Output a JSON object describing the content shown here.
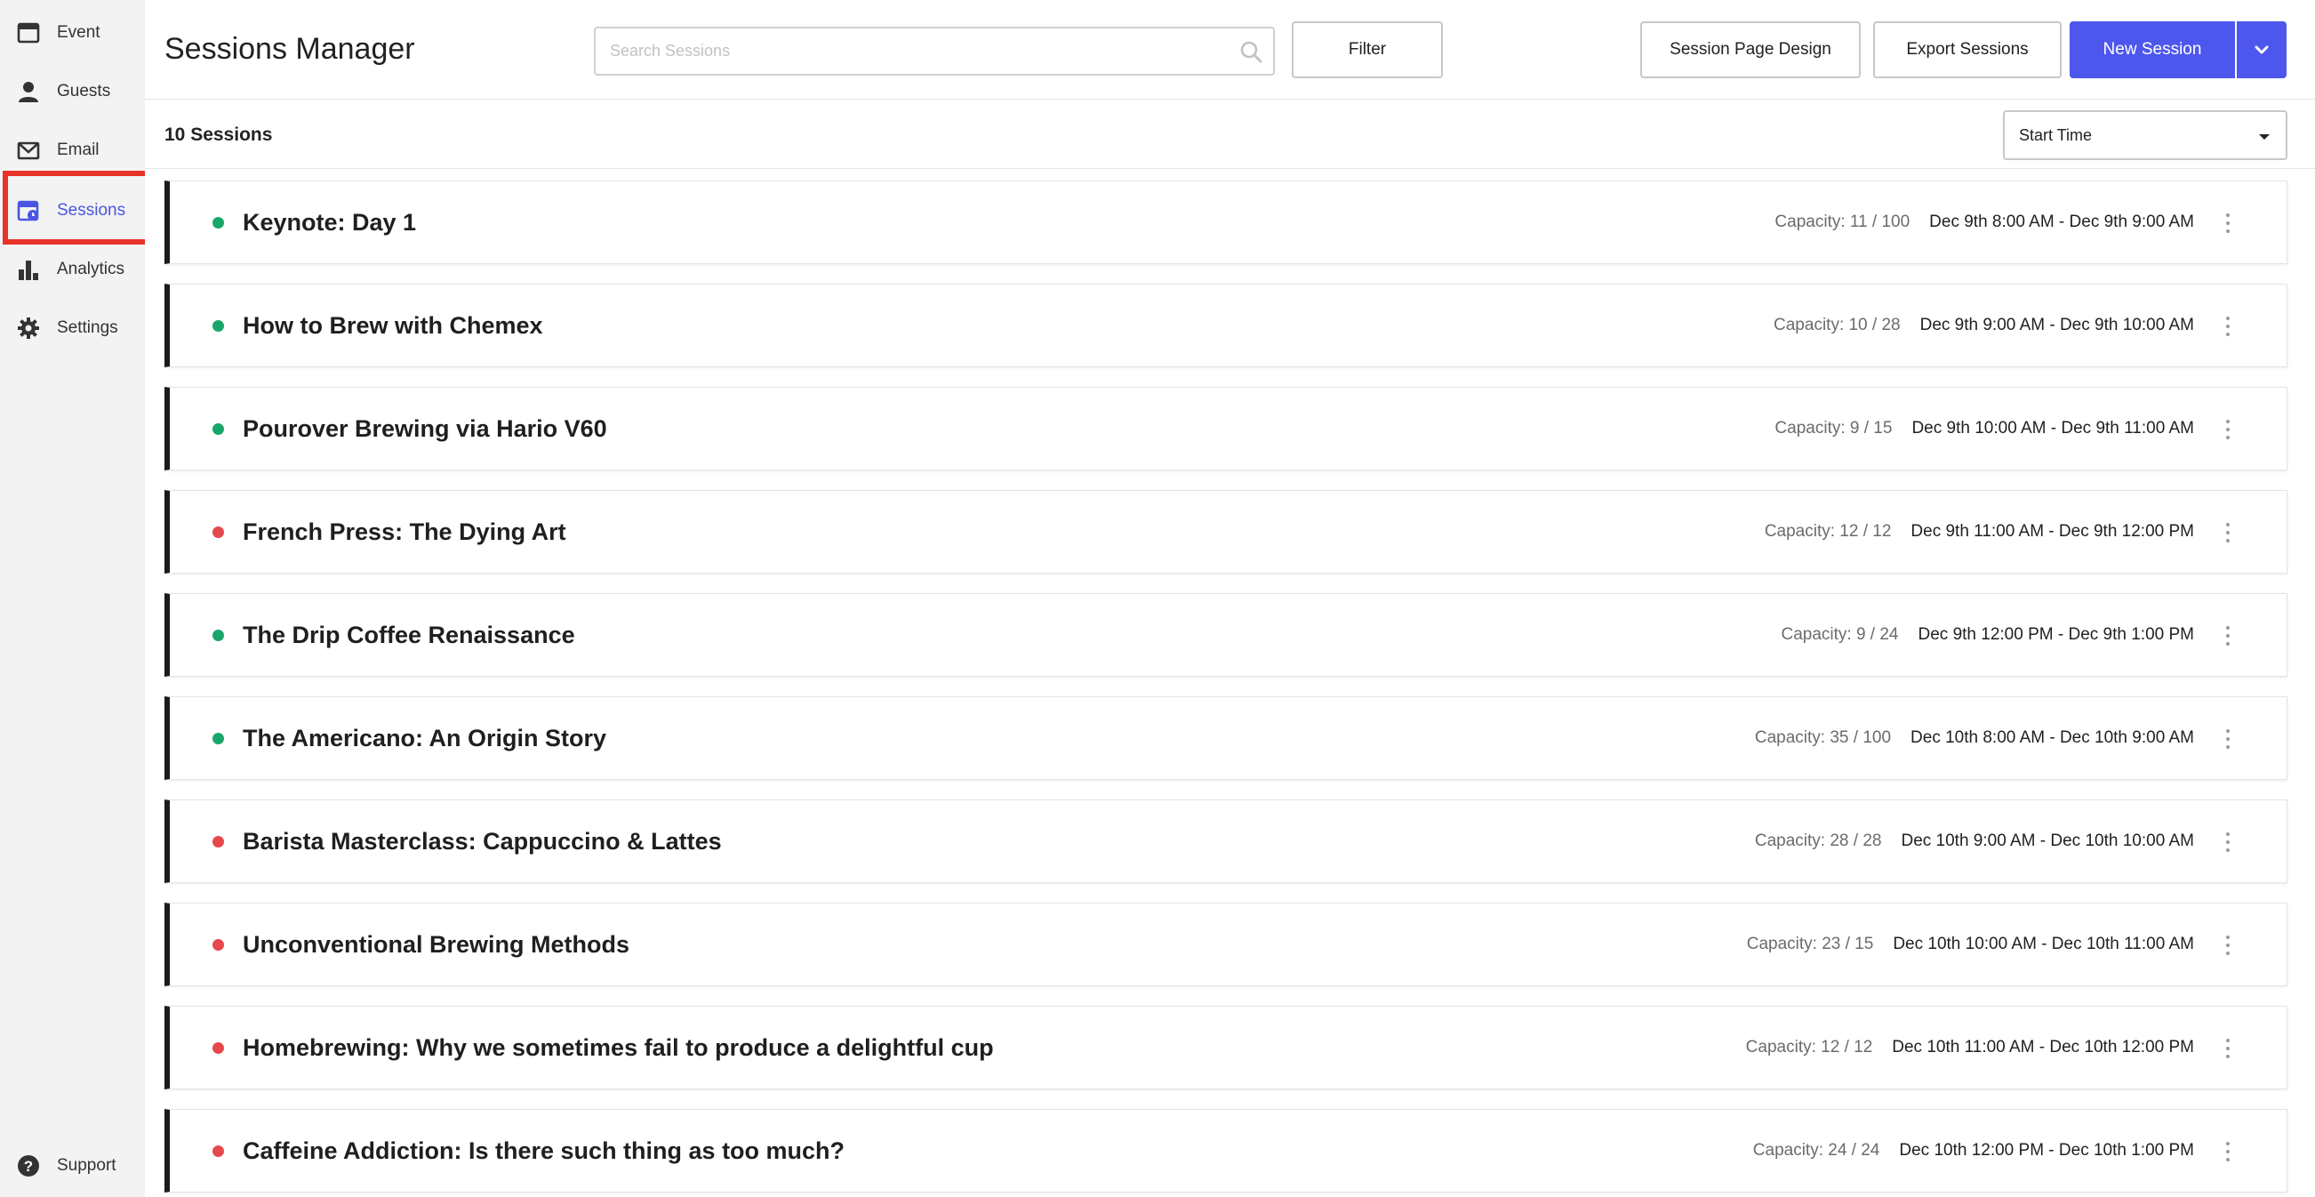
{
  "sidebar": {
    "items": [
      {
        "label": "Event",
        "icon": "calendar-icon"
      },
      {
        "label": "Guests",
        "icon": "person-icon"
      },
      {
        "label": "Email",
        "icon": "envelope-icon"
      },
      {
        "label": "Sessions",
        "icon": "sessions-icon",
        "active": true
      },
      {
        "label": "Analytics",
        "icon": "bar-chart-icon"
      },
      {
        "label": "Settings",
        "icon": "gear-icon"
      }
    ],
    "support_label": "Support"
  },
  "header": {
    "title": "Sessions Manager",
    "search_placeholder": "Search Sessions",
    "filter_label": "Filter",
    "design_label": "Session Page Design",
    "export_label": "Export Sessions",
    "new_label": "New Session"
  },
  "list": {
    "count_label": "10 Sessions",
    "sort_value": "Start Time",
    "sessions": [
      {
        "title": "Keynote: Day 1",
        "capacity": "Capacity: 11 / 100",
        "time": "Dec 9th 8:00 AM - Dec 9th 9:00 AM",
        "status": "available"
      },
      {
        "title": "How to Brew with Chemex",
        "capacity": "Capacity: 10 / 28",
        "time": "Dec 9th 9:00 AM - Dec 9th 10:00 AM",
        "status": "available"
      },
      {
        "title": "Pourover Brewing via Hario V60",
        "capacity": "Capacity: 9 / 15",
        "time": "Dec 9th 10:00 AM - Dec 9th 11:00 AM",
        "status": "available"
      },
      {
        "title": "French Press: The Dying Art",
        "capacity": "Capacity: 12 / 12",
        "time": "Dec 9th 11:00 AM - Dec 9th 12:00 PM",
        "status": "full"
      },
      {
        "title": "The Drip Coffee Renaissance",
        "capacity": "Capacity: 9 / 24",
        "time": "Dec 9th 12:00 PM - Dec 9th 1:00 PM",
        "status": "available"
      },
      {
        "title": "The Americano: An Origin Story",
        "capacity": "Capacity: 35 / 100",
        "time": "Dec 10th 8:00 AM - Dec 10th 9:00 AM",
        "status": "available"
      },
      {
        "title": "Barista Masterclass: Cappuccino & Lattes",
        "capacity": "Capacity: 28 / 28",
        "time": "Dec 10th 9:00 AM - Dec 10th 10:00 AM",
        "status": "full"
      },
      {
        "title": "Unconventional Brewing Methods",
        "capacity": "Capacity: 23 / 15",
        "time": "Dec 10th 10:00 AM - Dec 10th 11:00 AM",
        "status": "full"
      },
      {
        "title": "Homebrewing: Why we sometimes fail to produce a delightful cup",
        "capacity": "Capacity: 12 / 12",
        "time": "Dec 10th 11:00 AM - Dec 10th 12:00 PM",
        "status": "full"
      },
      {
        "title": "Caffeine Addiction: Is there such thing as too much?",
        "capacity": "Capacity: 24 / 24",
        "time": "Dec 10th 12:00 PM - Dec 10th 1:00 PM",
        "status": "full"
      }
    ]
  },
  "colors": {
    "accent": "#4d57ee",
    "available": "#1aa66a",
    "full": "#e5484d",
    "highlight": "#e8332a"
  }
}
